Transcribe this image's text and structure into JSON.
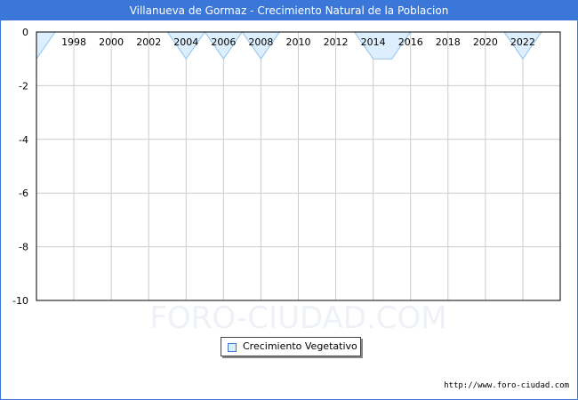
{
  "title": "Villanueva de Gormaz - Crecimiento Natural de la Poblacion",
  "footer_url": "http://www.foro-ciudad.com",
  "watermark": "FORO-CIUDAD.COM",
  "colors": {
    "accent": "#3a77d8",
    "fill": "#ddeeff",
    "stroke": "#8fc4ee",
    "grid": "#cccccc"
  },
  "chart_data": {
    "type": "area",
    "title": "Villanueva de Gormaz - Crecimiento Natural de la Poblacion",
    "xlabel": "",
    "ylabel": "",
    "xlim": [
      1996,
      2024
    ],
    "ylim": [
      -10,
      0
    ],
    "x_ticks": [
      1998,
      2000,
      2002,
      2004,
      2006,
      2008,
      2010,
      2012,
      2014,
      2016,
      2018,
      2020,
      2022
    ],
    "y_ticks": [
      0,
      -2,
      -4,
      -6,
      -8,
      -10
    ],
    "grid": true,
    "legend_position": "bottom-center",
    "series": [
      {
        "name": "Crecimiento Vegetativo",
        "x": [
          1996,
          1997,
          1998,
          1999,
          2000,
          2001,
          2002,
          2003,
          2004,
          2005,
          2006,
          2007,
          2008,
          2009,
          2010,
          2011,
          2012,
          2013,
          2014,
          2015,
          2016,
          2017,
          2018,
          2019,
          2020,
          2021,
          2022,
          2023
        ],
        "values": [
          -1,
          0,
          0,
          0,
          0,
          0,
          0,
          0,
          -1,
          0,
          -1,
          0,
          -1,
          0,
          0,
          0,
          0,
          0,
          -1,
          -1,
          0,
          0,
          0,
          0,
          0,
          0,
          -1,
          0
        ]
      }
    ]
  }
}
